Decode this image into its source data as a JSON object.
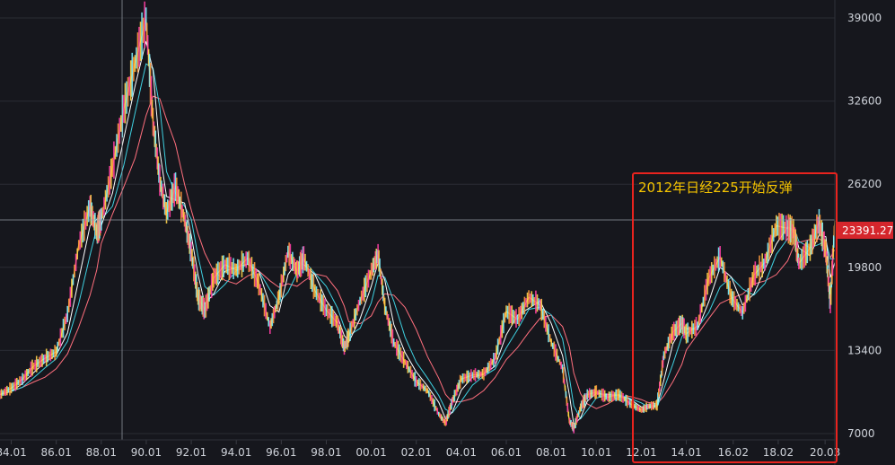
{
  "chart_data": {
    "type": "line",
    "title": "",
    "xlabel": "",
    "ylabel": "",
    "x_ticks": [
      "84.01",
      "86.01",
      "88.01",
      "90.01",
      "92.01",
      "94.01",
      "96.01",
      "98.01",
      "00.01",
      "02.01",
      "04.01",
      "06.01",
      "08.01",
      "10.01",
      "12.01",
      "14.01",
      "16.02",
      "18.02",
      "20.03"
    ],
    "y_ticks": [
      39000,
      32600,
      26200,
      19800,
      13400,
      7000
    ],
    "ylim": [
      7000,
      39000
    ],
    "xlim": [
      1983.5,
      2020.6
    ],
    "current_price": {
      "value": 23391.27,
      "label": "23391.27"
    },
    "annotation": {
      "text": "2012年日经225开始反弹",
      "highlight_from": "12.01",
      "highlight_to": "20.03"
    },
    "series": [
      {
        "color": "#ffd24a",
        "x": [
          1983.5,
          1984,
          1984.5,
          1985,
          1985.5,
          1986,
          1986.5,
          1987,
          1987.5,
          1987.8,
          1988,
          1988.5,
          1989,
          1989.5,
          1989.99,
          1990.3,
          1990.6,
          1990.9,
          1991.3,
          1991.7,
          1992,
          1992.3,
          1992.6,
          1993,
          1993.5,
          1994,
          1994.5,
          1995,
          1995.5,
          1995.9,
          1996.3,
          1996.7,
          1997,
          1997.5,
          1998,
          1998.5,
          1998.8,
          1999,
          1999.5,
          2000,
          2000.3,
          2000.6,
          2001,
          2001.5,
          2002,
          2002.5,
          2003,
          2003.3,
          2003.6,
          2004,
          2004.5,
          2005,
          2005.5,
          2006,
          2006.5,
          2007,
          2007.5,
          2008,
          2008.5,
          2008.8,
          2009,
          2009.3,
          2009.6,
          2010,
          2010.5,
          2011,
          2011.5,
          2012,
          2012.3,
          2012.7,
          2013,
          2013.4,
          2013.8,
          2014,
          2014.5,
          2015,
          2015.5,
          2016,
          2016.5,
          2017,
          2017.5,
          2018,
          2018.5,
          2018.8,
          2019,
          2019.5,
          2019.9,
          2020.2,
          2020.4,
          2020.6
        ],
        "values": [
          10000,
          10500,
          11200,
          12200,
          12800,
          13300,
          16200,
          21500,
          24500,
          22500,
          23500,
          27500,
          32000,
          35500,
          38900,
          31000,
          26500,
          24000,
          26000,
          23500,
          21000,
          17500,
          16500,
          19000,
          20000,
          19600,
          20500,
          18500,
          15200,
          17500,
          21000,
          19500,
          20500,
          18000,
          16500,
          15500,
          13600,
          14500,
          17200,
          19500,
          20800,
          16800,
          14000,
          12500,
          11000,
          10300,
          8500,
          7800,
          9500,
          11200,
          11500,
          11600,
          12800,
          16400,
          15800,
          17500,
          16900,
          14000,
          12000,
          8000,
          7400,
          9000,
          10000,
          10200,
          9800,
          10000,
          9300,
          8800,
          9100,
          9200,
          13000,
          14800,
          15500,
          14700,
          15300,
          19000,
          20600,
          17500,
          16300,
          19200,
          20200,
          23000,
          22800,
          22500,
          20100,
          21300,
          23300,
          21000,
          17000,
          23391
        ]
      }
    ]
  }
}
